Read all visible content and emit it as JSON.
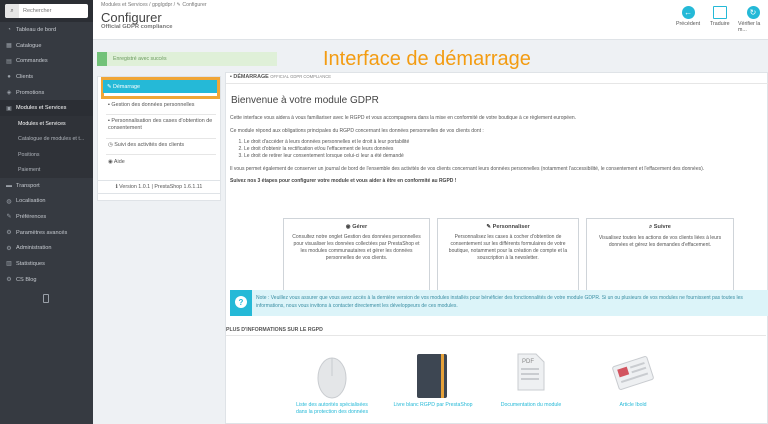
{
  "sidebar": {
    "search_placeholder": "Rechercher",
    "items": [
      {
        "label": "Tableau de bord",
        "icon": "dashboard-icon",
        "glyph": "◔"
      },
      {
        "label": "Catalogue",
        "icon": "catalog-icon",
        "glyph": "▦"
      },
      {
        "label": "Commandes",
        "icon": "orders-icon",
        "glyph": "▤"
      },
      {
        "label": "Clients",
        "icon": "clients-icon",
        "glyph": "●"
      },
      {
        "label": "Promotions",
        "icon": "promotions-icon",
        "glyph": "◈"
      },
      {
        "label": "Modules et Services",
        "icon": "modules-icon",
        "glyph": "▣"
      }
    ],
    "subitems": [
      {
        "label": "Modules et Services"
      },
      {
        "label": "Catalogue de modules et t..."
      },
      {
        "label": "Positions"
      },
      {
        "label": "Paiement"
      }
    ],
    "items_after": [
      {
        "label": "Transport",
        "icon": "transport-icon",
        "glyph": "▬"
      },
      {
        "label": "Localisation",
        "icon": "globe-icon",
        "glyph": "◍"
      },
      {
        "label": "Préférences",
        "icon": "wrench-icon",
        "glyph": "✎"
      },
      {
        "label": "Paramètres avancés",
        "icon": "cogs-icon",
        "glyph": "⚙"
      },
      {
        "label": "Administration",
        "icon": "admin-gear-icon",
        "glyph": "⚙"
      },
      {
        "label": "Statistiques",
        "icon": "stats-icon",
        "glyph": "▥"
      },
      {
        "label": "CS Blog",
        "icon": "blog-icon",
        "glyph": "⚙"
      }
    ]
  },
  "header": {
    "breadcrumb": "Modules et Services  /  gpglgdpr  /  ✎ Configurer",
    "title": "Configurer",
    "subtitle": "Official GDPR compliance",
    "tools": [
      {
        "label": "Précédent"
      },
      {
        "label": "Traduire"
      },
      {
        "label": "Vérifier la m..."
      }
    ]
  },
  "alert_success": "Enregistré avec succès",
  "overlay_title": "Interface de démarrage",
  "module_nav": {
    "active": "✎ Démarrage",
    "items": [
      "Gestion des données personnelles",
      "Personnalisation des cases d'obtention de consentement",
      "Suivi des activités des clients",
      "Aide"
    ],
    "version": "Version 1.0.1  |  PrestaShop 1.6.1.11"
  },
  "panel": {
    "head": "DÉMARRAGE",
    "head_small": "OFFICIAL GDPR COMPLIANCE",
    "welcome": "Bienvenue à votre module GDPR",
    "p1": "Cette interface vous aidera à vous familiariser avec le RGPD et vous accompagnera dans la mise en conformité de votre boutique à ce règlement européen.",
    "p2": "Ce module répond aux obligations principales du RGPD concernant les données personnelles de vos clients dont :",
    "list": [
      "Le droit d'accéder à leurs données personnelles et le droit à leur portabilité",
      "Le droit d'obtenir la rectification et/ou l'effacement de leurs données",
      "Le droit de retirer leur consentement lorsque celui-ci leur a été demandé"
    ],
    "p3": "Il vous permet également de conserver un journal de bord de l'ensemble des activités de vos clients concernant leurs données personnelles (notamment l'accessibilité, le consentement et l'effacement des données).",
    "p4": "Suivez nos 3 étapes pour configurer votre module et vous aider à être en conformité au RGPD !",
    "cards": [
      {
        "title": "Gérer",
        "body": "Consultez notre onglet Gestion des données personnelles pour visualiser les données collectées par PrestaShop et les modules communautaires et gérer les données personnelles de vos clients."
      },
      {
        "title": "Personnaliser",
        "body": "Personnalisez les cases à cocher d'obtention de consentement sur les différents formulaires de votre boutique, notamment pour la création de compte et la souscription à la newsletter."
      },
      {
        "title": "Suivre",
        "body": "Visualisez toutes les actions de vos clients liées à leurs données et gérez les demandes d'effacement."
      }
    ],
    "note": "Note : Veuillez vous assurer que vous avez accès à la dernière version de vos modules installés pour bénéficier des fonctionnalités de votre module GDPR. Si un ou plusieurs de vos modules ne fournissent pas toutes les informations, nous vous invitons à contacter directement les développeurs de ces modules.",
    "more_title": "PLUS D'INFORMATIONS SUR LE RGPD",
    "resources": [
      {
        "label": "Liste des autorités spécialisées dans la protection des données"
      },
      {
        "label": "Livre blanc RGPD par PrestaShop"
      },
      {
        "label": "Documentation du module"
      },
      {
        "label": "Article Ibold"
      }
    ]
  },
  "colors": {
    "sidebar": "#363a41",
    "accent": "#25b9d7",
    "highlight": "#f39c12",
    "success": "#72c279"
  }
}
